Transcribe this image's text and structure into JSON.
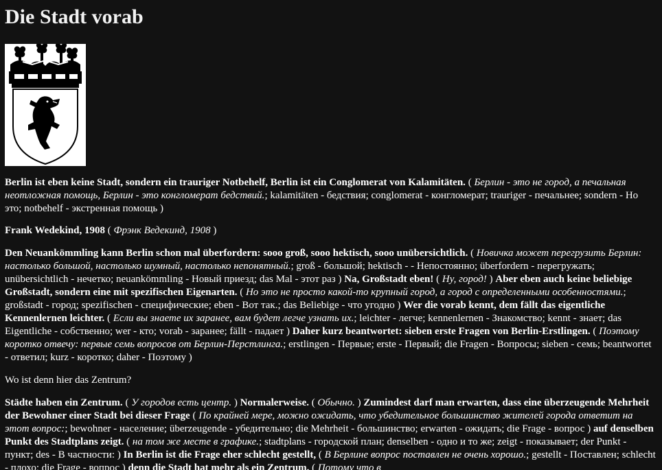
{
  "heading": "Die Stadt vorab",
  "crest_icon": "berlin-bear-crest-icon",
  "p1": {
    "de": "Berlin ist eben keine Stadt, sondern ein trauriger Notbehelf, Berlin ist ein Conglomerat von Kalamitäten.",
    "ru": "Берлин - это не город, а печальная неотложная помощь, Берлин - это конгломерат бедствий.",
    "vocab": "kalamitäten - бедствия; conglomerat - конгломерат; trauriger - печальнее; sondern - Но это; notbehelf - экстренная помощь"
  },
  "p2": {
    "de": "Frank Wedekind, 1908",
    "ru": "Фрэнк Ведекинд, 1908"
  },
  "p3": {
    "s1_de": "Den Neuankömmling kann Berlin schon mal überfordern: sooo groß, sooo hektisch, sooo unübersichtlich.",
    "s1_ru": "Новичка может перегрузить Берлин: настолько большой, настолько шумный, настолько непонятный.",
    "s1_vocab": "groß - большой; hektisch - - Непостоянно; überfordern - перегружать; unübersichtlich - нечетко; neuankömmling - Новый приезд; das Mal - этот раз",
    "s2_de": "Na, Großstadt eben!",
    "s2_ru": "Ну, город!",
    "s3_de": "Aber eben auch keine beliebige Großstadt, sondern eine mit spezifischen Eigenarten.",
    "s3_ru": "Но это не просто какой-то крупный город, а город с определенными особенностями.",
    "s3_vocab": "großstadt - город; spezifischen - специфические; eben - Вот так.; das Beliebige - что угодно",
    "s4_de": "Wer die vorab kennt, dem fällt das eigentliche Kennenlernen leichter.",
    "s4_ru": "Если вы знаете их заранее, вам будет легче узнать их.",
    "s4_vocab": "leichter - легче; kennenlernen - Знакомство; kennt - знает; das Eigentliche - собственно; wer - кто; vorab - заранее; fällt - падает",
    "s5_de": "Daher kurz beantwortet: sieben erste Fragen von Berlin-Erstlingen.",
    "s5_ru": "Поэтому коротко отвечу: первые семь вопросов от Берлин-Перстлинга.",
    "s5_vocab": "erstlingen - Первые; erste - Первый; die Fragen - Вопросы; sieben - семь; beantwortet - ответил; kurz - коротко; daher - Поэтому"
  },
  "p4": {
    "text": "Wo ist denn hier das Zentrum?"
  },
  "p5": {
    "s1_de": "Städte haben ein Zentrum.",
    "s1_ru": "У городов есть центр.",
    "s2_de": "Normalerweise.",
    "s2_ru": "Обычно.",
    "s3_de": "Zumindest darf man erwarten, dass eine überzeugende Mehrheit der Bewohner einer Stadt bei dieser Frage",
    "s3_ru": "По крайней мере, можно ожидать, что убедительное большинство жителей города ответит на этот вопрос:",
    "s3_vocab": "bewohner - население; überzeugende - убедительно; die Mehrheit - большинство; erwarten - ожидать; die Frage - вопрос",
    "s4_de": "auf denselben Punkt des Stadtplans zeigt.",
    "s4_ru": "на том же месте в графике.",
    "s4_vocab": "stadtplans - городской план; denselben - одно и то же; zeigt - показывает; der Punkt - пункт; des - В частности:",
    "s5_de": "In Berlin ist die Frage eher schlecht gestellt,",
    "s5_ru": "В Берлине вопрос поставлен не очень хорошо.",
    "s5_vocab": "gestellt - Поставлен; schlecht - плохо; die Frage - вопрос",
    "s6_de": "denn die Stadt hat mehr als ein Zentrum.",
    "s6_ru": "Потому что в"
  }
}
